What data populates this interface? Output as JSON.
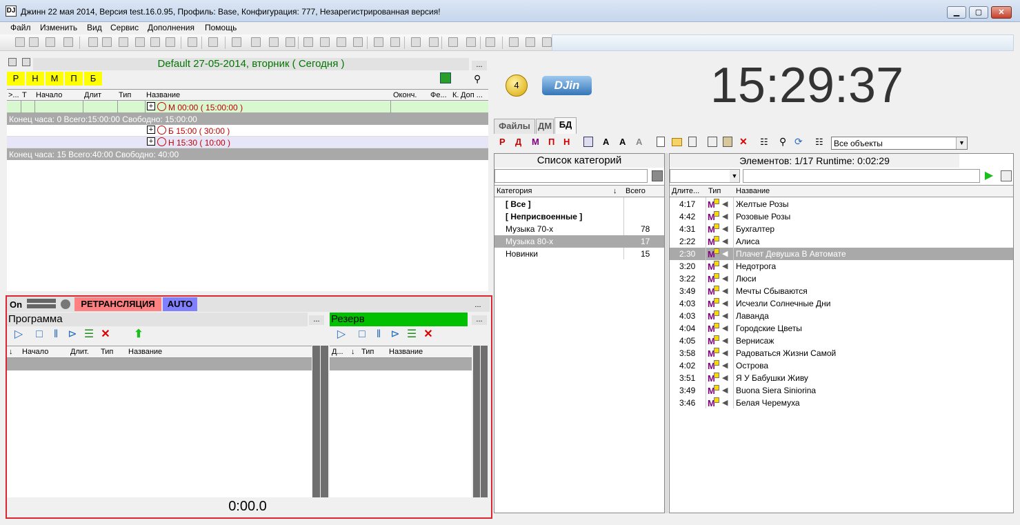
{
  "window": {
    "title": "Джинн 22 мая 2014, Версия test.16.0.95, Профиль: Base, Конфигурация: 777, Незарегистрированная версия!",
    "min_label": "▁",
    "max_label": "▢",
    "close_label": "✕"
  },
  "menu": [
    "Файл",
    "Изменить",
    "Вид",
    "Сервис",
    "Дополнения",
    "Помощь"
  ],
  "schedule": {
    "title": "Default 27-05-2014, вторник ( Сегодня )",
    "dots": "...",
    "buttons": [
      "Р",
      "Н",
      "М",
      "П",
      "Б"
    ],
    "columns": [
      ">...",
      "Т",
      "Начало",
      "Длит",
      "Тип",
      "Название",
      "Оконч.",
      "Фе...",
      "К.",
      "Доп ..."
    ],
    "blocks": [
      {
        "label": "М 00:00 ( 15:00:00 )"
      },
      {
        "summary": "Конец часа: 0 Всего:15:00:00 Свободно: 15:00:00"
      },
      {
        "label": "Б 15:00 ( 30:00 )"
      },
      {
        "label": "Н 15:30 ( 10:00 )"
      },
      {
        "summary": "Конец часа: 15 Всего:40:00 Свободно: 40:00"
      }
    ]
  },
  "player": {
    "on_label": "On",
    "relay_label": "РЕТРАНСЛЯЦИЯ",
    "auto_label": "AUTO",
    "dots": "...",
    "program": {
      "title": "Программа",
      "columns": [
        "Начало",
        "Длит.",
        "Тип",
        "Название"
      ]
    },
    "reserve": {
      "title": "Резерв",
      "columns": [
        "Д...",
        "Тип",
        "Название"
      ]
    },
    "time": "0:00.0"
  },
  "clock": {
    "badge": "4",
    "logo": "DJin",
    "time": "15:29:37"
  },
  "tabs": [
    "Файлы",
    "ДМ",
    "БД"
  ],
  "db_toolbar": {
    "type_buttons": [
      "Р",
      "Д",
      "М",
      "П",
      "Н"
    ],
    "filter_value": "Все объекты"
  },
  "categories": {
    "title": "Список категорий",
    "col_category": "Категория",
    "col_total": "Всего",
    "rows": [
      {
        "name": "[ Все ]",
        "count": ""
      },
      {
        "name": "[ Неприсвоенные ]",
        "count": ""
      },
      {
        "name": "Музыка 70-х",
        "count": "78"
      },
      {
        "name": "Музыка 80-х",
        "count": "17"
      },
      {
        "name": "Новинки",
        "count": "15"
      }
    ]
  },
  "elements": {
    "summary": "Элементов: 1/17   Runtime: 0:02:29",
    "columns": [
      "Длите...",
      "Тип",
      "Название"
    ],
    "type_letter": "М",
    "rows": [
      {
        "dur": "4:17",
        "name": "Желтые Розы"
      },
      {
        "dur": "4:42",
        "name": "Розовые Розы"
      },
      {
        "dur": "4:31",
        "name": "Бухгалтер"
      },
      {
        "dur": "2:22",
        "name": "Алиса"
      },
      {
        "dur": "2:30",
        "name": "Плачет Девушка В Автомате"
      },
      {
        "dur": "3:20",
        "name": "Недотрога"
      },
      {
        "dur": "3:22",
        "name": "Люси"
      },
      {
        "dur": "3:49",
        "name": "Мечты Сбываются"
      },
      {
        "dur": "4:03",
        "name": "Исчезли Солнечные Дни"
      },
      {
        "dur": "4:03",
        "name": "Лаванда"
      },
      {
        "dur": "4:04",
        "name": "Городские Цветы"
      },
      {
        "dur": "4:05",
        "name": "Вернисаж"
      },
      {
        "dur": "3:58",
        "name": "Радоваться Жизни Самой"
      },
      {
        "dur": "4:02",
        "name": "Острова"
      },
      {
        "dur": "3:51",
        "name": "Я У Бабушки Живу"
      },
      {
        "dur": "3:49",
        "name": "Buona Siera Siniorina"
      },
      {
        "dur": "3:46",
        "name": "Белая Черемуха"
      }
    ]
  },
  "colors": {
    "accent_green": "#00c000",
    "relay_red": "#ff8080",
    "auto_blue": "#8080ff",
    "highlight_yellow": "#ffff00",
    "selected_row": "#a9a9a9",
    "frame_red": "#d9262f"
  }
}
